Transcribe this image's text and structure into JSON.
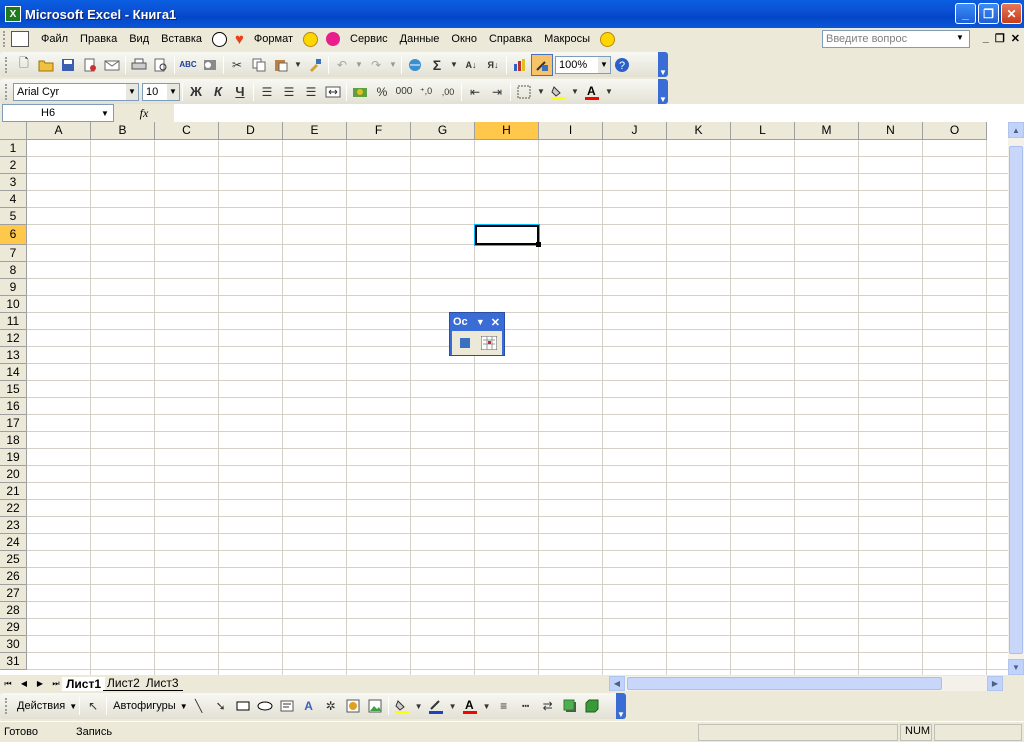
{
  "window": {
    "title": "Microsoft Excel - Книга1",
    "app_icon": "X",
    "minimize": "_",
    "restore": "❐",
    "close": "✕"
  },
  "menu": {
    "items": [
      "Файл",
      "Правка",
      "Вид",
      "Вставка",
      "Формат",
      "Сервис",
      "Данные",
      "Окно",
      "Справка",
      "Макросы"
    ],
    "ask_placeholder": "Введите вопрос",
    "doc_minimize": "_",
    "doc_restore": "❐",
    "doc_close": "✕"
  },
  "standard_toolbar": {
    "zoom": "100%"
  },
  "formatting_toolbar": {
    "font": "Arial Cyr",
    "size": "10",
    "bold": "Ж",
    "italic": "К",
    "underline": "Ч",
    "percent": "%",
    "thousands": "000",
    "inc_decimal": "⁺,0",
    "dec_decimal": ",00"
  },
  "formula_bar": {
    "name_box": "H6",
    "fx": "fx",
    "value": ""
  },
  "sheet": {
    "columns": [
      "A",
      "B",
      "C",
      "D",
      "E",
      "F",
      "G",
      "H",
      "I",
      "J",
      "K",
      "L",
      "M",
      "N",
      "O"
    ],
    "rows": [
      "1",
      "2",
      "3",
      "4",
      "5",
      "6",
      "7",
      "8",
      "9",
      "10",
      "11",
      "12",
      "13",
      "14",
      "15",
      "16",
      "17",
      "18",
      "19",
      "20",
      "21",
      "22",
      "23",
      "24",
      "25",
      "26",
      "27",
      "28",
      "29",
      "30",
      "31"
    ],
    "selected_column": "H",
    "selected_row": "6"
  },
  "floating_toolbar": {
    "title": "Oc"
  },
  "sheet_tabs": [
    "Лист1",
    "Лист2",
    "Лист3"
  ],
  "active_sheet": "Лист1",
  "drawing_toolbar": {
    "actions": "Действия",
    "autoshapes": "Автофигуры"
  },
  "status": {
    "ready": "Готово",
    "record": "Запись",
    "num": "NUM"
  },
  "colors": {
    "titlebar": "#0a5fe0",
    "selected_header": "#ffc84a",
    "gridline": "#d4d0c8"
  }
}
